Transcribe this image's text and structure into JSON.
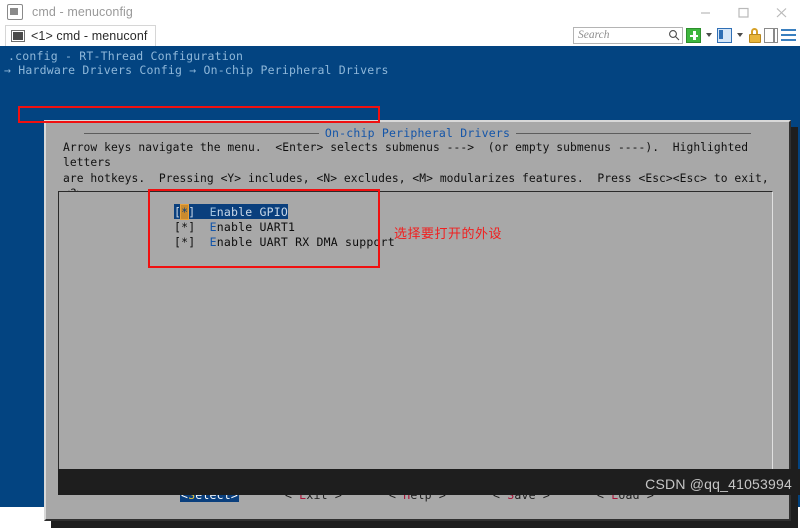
{
  "window": {
    "title": "cmd - menuconfig",
    "icon": "console-window-icon",
    "controls": {
      "minimize": "minimize-icon",
      "maximize": "maximize-icon",
      "close": "close-icon"
    }
  },
  "tab": {
    "label": "<1> cmd - menuconf",
    "icon": "cmd-icon"
  },
  "toolbar": {
    "search": {
      "placeholder": "Search",
      "value": "",
      "icon": "search-icon"
    },
    "new_tab": "plus-icon",
    "new_tab_caret": "chevron-down-icon",
    "pane": "window-icon",
    "pane_caret": "chevron-down-icon",
    "lock": "lock-icon",
    "split": "split-pane-icon",
    "menu": "hamburger-menu-icon"
  },
  "console": {
    "config_line": ".config - RT-Thread Configuration",
    "breadcrumb": "→ Hardware Drivers Config → On-chip Peripheral Drivers"
  },
  "dialog": {
    "title": "On-chip Peripheral Drivers",
    "help": "Arrow keys navigate the menu.  <Enter> selects submenus --->  (or empty submenus ----).  Highlighted letters\nare hotkeys.  Pressing <Y> includes, <N> excludes, <M> modularizes features.  Press <Esc><Esc> to exit, <?>\nfor Help, </> for Search.  Legend: [*] built-in  [ ] excluded  <M> module  < > module capable",
    "menu_items": [
      {
        "marker_open": "[",
        "marker_state": "*",
        "marker_close": "]",
        "hotkey": "E",
        "label_rest": "nable GPIO",
        "selected": true
      },
      {
        "marker_open": "[",
        "marker_state": "*",
        "marker_close": "]",
        "hotkey": "E",
        "label_rest": "nable UART1",
        "selected": false
      },
      {
        "marker_open": "[",
        "marker_state": "*",
        "marker_close": "]",
        "hotkey": "E",
        "label_rest": "nable UART RX DMA support",
        "selected": false
      }
    ],
    "buttons": [
      {
        "left": "<",
        "hotkey": "S",
        "rest": "elect",
        "right": ">",
        "selected": true
      },
      {
        "left": "< ",
        "hotkey": "E",
        "rest": "xit",
        "right": " >",
        "selected": false
      },
      {
        "left": "< ",
        "hotkey": "H",
        "rest": "elp",
        "right": " >",
        "selected": false
      },
      {
        "left": "< ",
        "hotkey": "S",
        "rest": "ave",
        "right": " >",
        "selected": false
      },
      {
        "left": "< ",
        "hotkey": "L",
        "rest": "oad",
        "right": " >",
        "selected": false
      }
    ]
  },
  "annotations": {
    "note_text": "选择要打开的外设",
    "color": "#f02020"
  },
  "watermark": {
    "text": "CSDN @qq_41053994"
  },
  "colors": {
    "console_blue": "#034481",
    "dialog_gray": "#a8a8a8",
    "highlight_blue": "#0a3f7d",
    "hotkey_blue": "#1455a8",
    "hotkey_red": "#a81438",
    "annotation_red": "#f02020"
  }
}
